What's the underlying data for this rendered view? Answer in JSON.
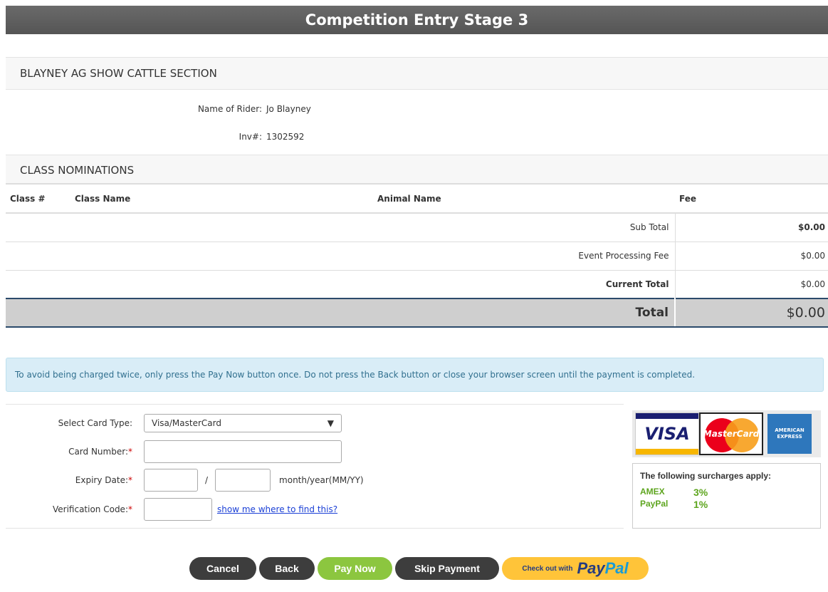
{
  "page": {
    "title": "Competition Entry Stage 3"
  },
  "event": {
    "heading": "BLAYNEY AG SHOW CATTLE SECTION",
    "rider_label": "Name of Rider:",
    "rider_value": "Jo Blayney",
    "inv_label": "Inv#:",
    "inv_value": "1302592"
  },
  "nominations": {
    "heading": "CLASS NOMINATIONS",
    "columns": [
      "Class #",
      "Class Name",
      "Animal Name",
      "Fee"
    ],
    "rows": [],
    "subtotal_label": "Sub Total",
    "subtotal_value": "$0.00",
    "processing_label": "Event Processing Fee",
    "processing_value": "$0.00",
    "current_label": "Current Total",
    "current_value": "$0.00",
    "total_label": "Total",
    "total_value": "$0.00"
  },
  "alert": {
    "text": "To avoid being charged twice, only press the Pay Now button once. Do not press the Back button or close your browser screen until the payment is completed."
  },
  "payment_form": {
    "card_type_label": "Select Card Type:",
    "card_type_value": "Visa/MasterCard",
    "card_number_label": "Card Number:",
    "expiry_label": "Expiry Date:",
    "expiry_sep": "/",
    "expiry_hint": "month/year(MM/YY)",
    "cvv_label": "Verification Code:",
    "cvv_link": "show me where to find this?",
    "required_mark": "*"
  },
  "cards": {
    "visa": "VISA",
    "mastercard": "MasterCard",
    "amex": "AMERICAN EXPRESS"
  },
  "surcharges": {
    "title": "The following surcharges apply:",
    "items": [
      {
        "name": "AMEX",
        "pct": "3%"
      },
      {
        "name": "PayPal",
        "pct": "1%"
      }
    ],
    "color": "#5ea51f"
  },
  "buttons": {
    "cancel": "Cancel",
    "back": "Back",
    "pay_now": "Pay Now",
    "skip": "Skip Payment",
    "paypal_prefix": "Check out with",
    "paypal_a": "Pay",
    "paypal_b": "Pal"
  },
  "colors": {
    "title_bar": "#5e5e5e",
    "pay_now": "#8cc63f",
    "dark_button": "#3d3d3d",
    "paypal": "#ffc439",
    "alert_bg": "#d9edf7"
  }
}
